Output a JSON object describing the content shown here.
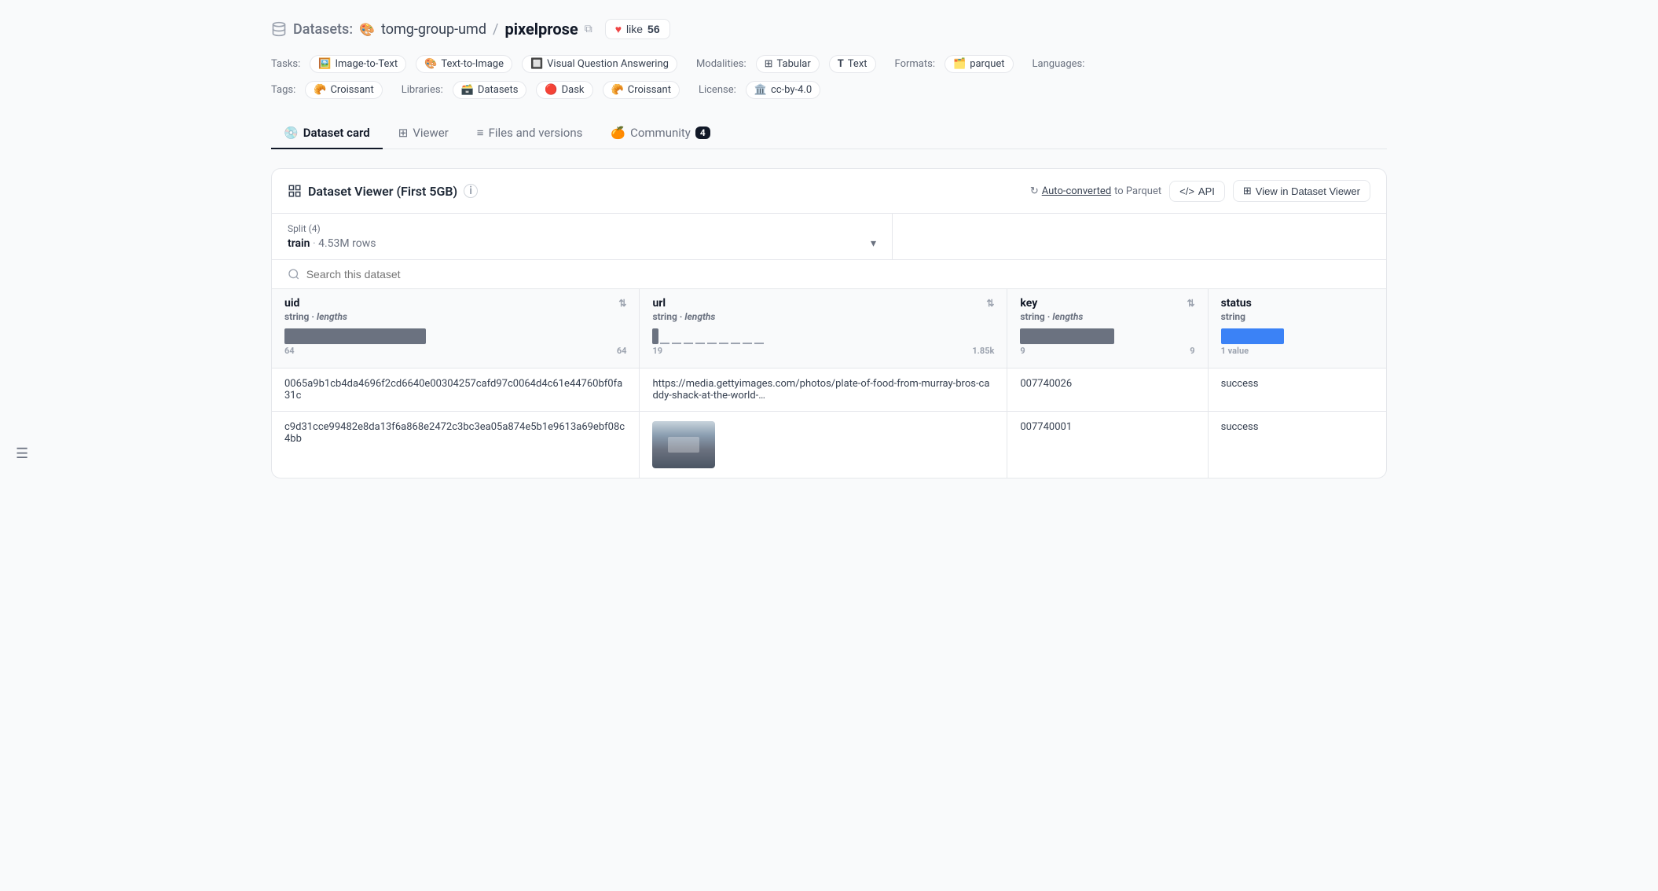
{
  "breadcrumb": {
    "datasets_label": "Datasets:",
    "org_name": "tomg-group-umd",
    "slash": "/",
    "repo_name": "pixelprose",
    "like_label": "like",
    "like_count": "56"
  },
  "tasks": {
    "label": "Tasks:",
    "items": [
      {
        "icon": "🖼",
        "label": "Image-to-Text"
      },
      {
        "icon": "🎨",
        "label": "Text-to-Image"
      },
      {
        "icon": "🔲",
        "label": "Visual Question Answering"
      }
    ]
  },
  "modalities": {
    "label": "Modalities:",
    "items": [
      {
        "icon": "⊞",
        "label": "Tabular"
      },
      {
        "icon": "T",
        "label": "Text"
      }
    ]
  },
  "formats": {
    "label": "Formats:",
    "items": [
      {
        "icon": "🗂",
        "label": "parquet"
      }
    ]
  },
  "languages_label": "Languages:",
  "tags": {
    "label": "Tags:",
    "items": [
      {
        "icon": "🥐",
        "label": "Croissant"
      }
    ]
  },
  "libraries": {
    "label": "Libraries:",
    "items": [
      {
        "icon": "🗃",
        "label": "Datasets"
      },
      {
        "icon": "🔴",
        "label": "Dask"
      },
      {
        "icon": "🥐",
        "label": "Croissant"
      }
    ]
  },
  "license": {
    "label": "License:",
    "value": "cc-by-4.0"
  },
  "tabs": [
    {
      "id": "dataset-card",
      "label": "Dataset card",
      "icon": "💿",
      "active": true
    },
    {
      "id": "viewer",
      "label": "Viewer",
      "icon": "⊞"
    },
    {
      "id": "files-and-versions",
      "label": "Files and versions",
      "icon": "≡"
    },
    {
      "id": "community",
      "label": "Community",
      "icon": "🍊",
      "badge": "4"
    }
  ],
  "viewer": {
    "title": "Dataset Viewer (First 5GB)",
    "auto_converted_text": "Auto-converted",
    "to_parquet_text": "to Parquet",
    "api_label": "API",
    "view_label": "View in Dataset Viewer",
    "split_section": {
      "label": "Split (4)",
      "name": "train",
      "rows": "4.53M rows"
    },
    "search_placeholder": "Search this dataset",
    "columns": [
      {
        "id": "uid",
        "label": "uid",
        "type": "string",
        "sub": "lengths",
        "min": "64",
        "max": "64"
      },
      {
        "id": "url",
        "label": "url",
        "type": "string",
        "sub": "lengths",
        "min": "19",
        "max": "1.85k"
      },
      {
        "id": "key",
        "label": "key",
        "type": "string",
        "sub": "lengths",
        "min": "9",
        "max": "9"
      },
      {
        "id": "status",
        "label": "status",
        "type": "string",
        "sub": "",
        "values_label": "1 value"
      }
    ],
    "rows": [
      {
        "uid": "0065a9b1cb4da4696f2cd6640e00304257cafd97c0064d4c61e44760bf0fa31c",
        "url": "https://media.gettyimages.com/photos/plate-of-food-from-murray-bros-caddy-shack-at-the-world-…",
        "url_has_thumbnail": false,
        "key": "007740026",
        "status": "success"
      },
      {
        "uid": "c9d31cce99482e8da13f6a868e2472c3bc3ea05a874e5b1e9613a69ebf08c4bb",
        "url": "",
        "url_has_thumbnail": true,
        "key": "007740001",
        "status": "success"
      }
    ]
  }
}
